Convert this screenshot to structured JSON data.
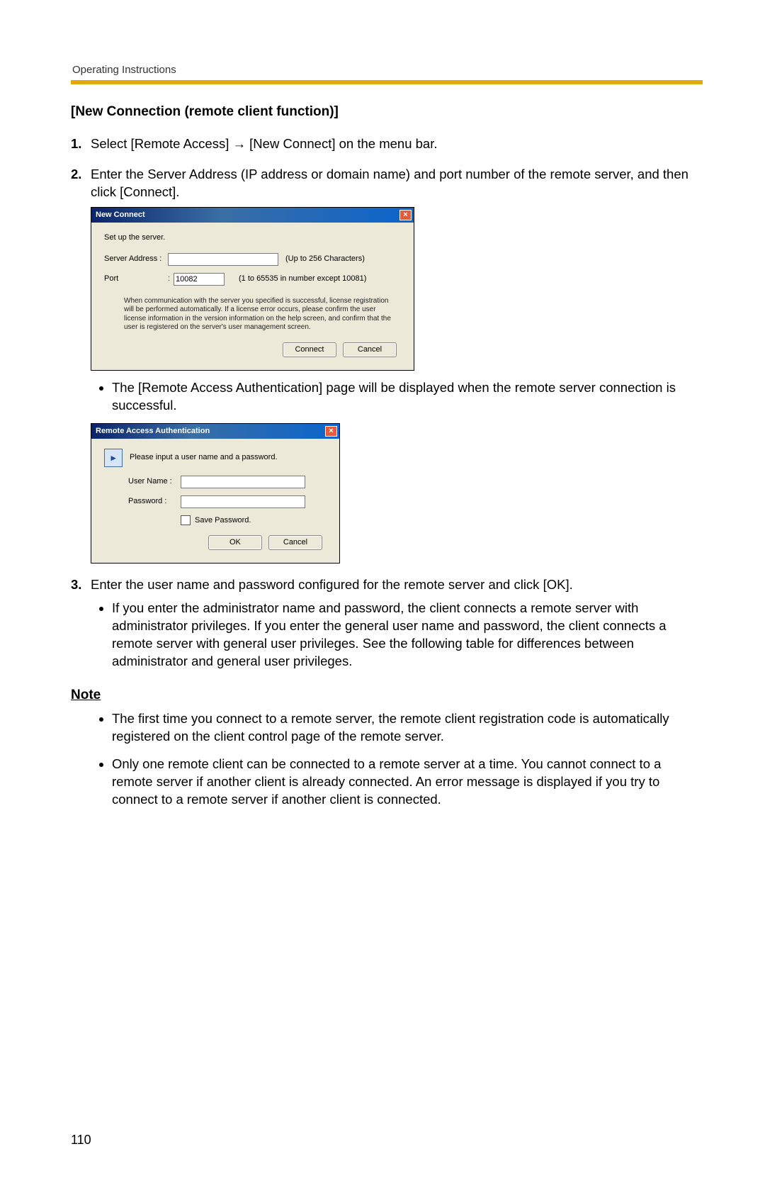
{
  "header": "Operating Instructions",
  "sectionTitle": "[New Connection (remote client function)]",
  "step1": {
    "num": "1.",
    "textA": "Select [Remote Access]",
    "arrow": "→",
    "textB": "[New Connect] on the menu bar."
  },
  "step2": {
    "num": "2.",
    "text": "Enter the Server Address (IP address or domain name) and port number of the remote server, and then click [Connect]."
  },
  "dialog1": {
    "title": "New Connect",
    "intro": "Set up the server.",
    "serverLabel": "Server Address :",
    "serverHint": "(Up to 256 Characters)",
    "portLabel": "Port",
    "portColon": ":",
    "portValue": "10082",
    "portHint": "(1 to 65535 in number except 10081)",
    "help": "When communication with the server you specified is successful, license registration will be performed automatically. If a license error occurs, please confirm the user license information in the version information on the help screen, and confirm that the user is registered on the server's user management screen.",
    "btnConnect": "Connect",
    "btnCancel": "Cancel"
  },
  "bullet1": "The [Remote Access Authentication] page will be displayed when the remote server connection is successful.",
  "dialog2": {
    "title": "Remote Access Authentication",
    "prompt": "Please input a user name and a password.",
    "userLabel": "User Name  :",
    "passLabel": "Password   :",
    "saveLabel": "Save Password.",
    "btnOk": "OK",
    "btnCancel": "Cancel"
  },
  "step3": {
    "num": "3.",
    "text": "Enter the user name and password configured for the remote server and click [OK].",
    "sub": "If you enter the administrator name and password, the client connects a remote server with administrator privileges. If you enter the general user name and password, the client connects a remote server with general user privileges. See the following table for differences between administrator and general user privileges."
  },
  "noteHeading": "Note",
  "noteBullets": [
    "The first time you connect to a remote server, the remote client registration code is automatically registered on the client control page of the remote server.",
    "Only one remote client can be connected to a remote server at a time. You cannot connect to a remote server if another client is already connected. An error message is displayed if you try to connect to a remote server if another client is connected."
  ],
  "pageNumber": "110"
}
